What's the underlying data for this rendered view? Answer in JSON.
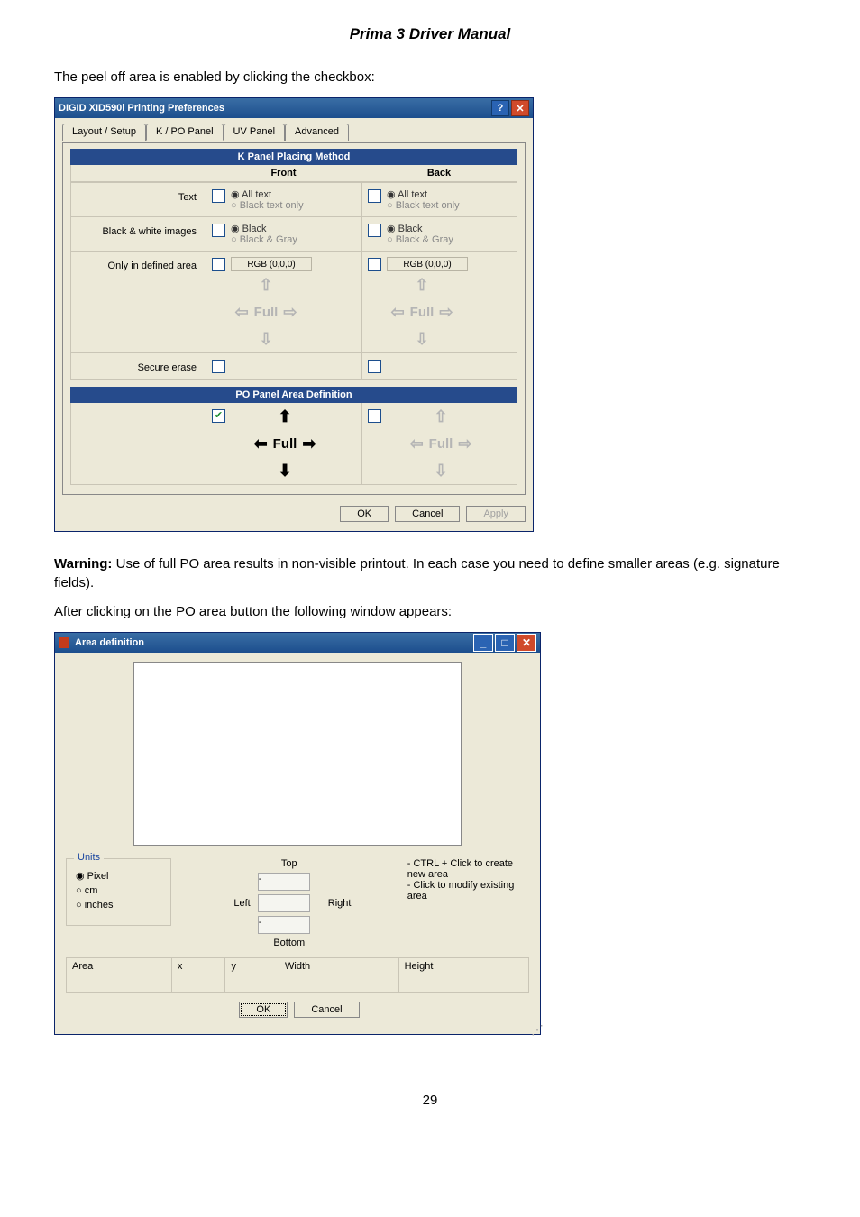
{
  "doc": {
    "title": "Prima 3 Driver Manual",
    "intro_line": "The peel off area is enabled by clicking the checkbox:",
    "warning_lead": "Warning:",
    "warning_text": " Use of full PO area results in non-visible printout. In each case you need to define smaller areas (e.g. signature fields).",
    "after_line": "After clicking on the PO area button the following window appears:",
    "page_num": "29"
  },
  "dlg1": {
    "title": "DIGID XID590i Printing Preferences",
    "tabs": [
      "Layout / Setup",
      "K / PO Panel",
      "UV Panel",
      "Advanced"
    ],
    "active_tab": 1,
    "banner1": "K Panel Placing Method",
    "col_front": "Front",
    "col_back": "Back",
    "rows": {
      "text": "Text",
      "bw": "Black & white images",
      "defined": "Only in defined area",
      "secure": "Secure erase"
    },
    "radio_alltext": "All text",
    "radio_blacktext": "Black text only",
    "radio_black": "Black",
    "radio_blackgray": "Black & Gray",
    "rgb_btn": "RGB (0,0,0)",
    "banner2": "PO Panel Area Definition",
    "full_label": "Full",
    "buttons": {
      "ok": "OK",
      "cancel": "Cancel",
      "apply": "Apply"
    }
  },
  "dlg2": {
    "title": "Area definition",
    "units_legend": "Units",
    "units": {
      "pixel": "Pixel",
      "cm": "cm",
      "inches": "inches"
    },
    "pos": {
      "top": "Top",
      "left": "Left",
      "right": "Right",
      "bottom": "Bottom"
    },
    "hint1": "- CTRL + Click to create new area",
    "hint2": "- Click to modify existing area",
    "tbl": {
      "area": "Area",
      "x": "x",
      "y": "y",
      "w": "Width",
      "h": "Height"
    },
    "ok": "OK",
    "cancel": "Cancel"
  }
}
